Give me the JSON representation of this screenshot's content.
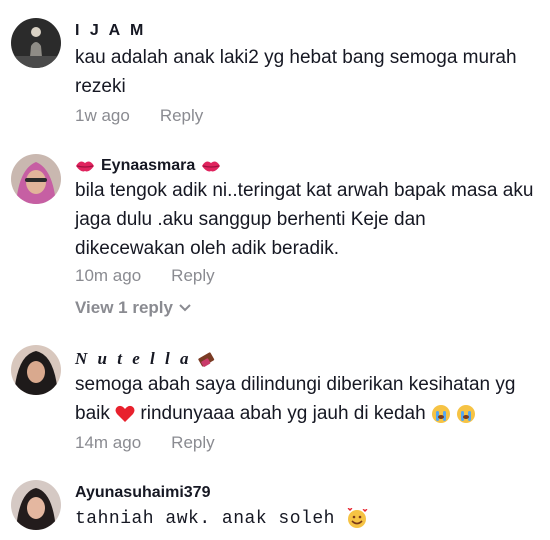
{
  "comments": [
    {
      "username": "I J A M",
      "text": "kau adalah anak laki2 yg hebat bang semoga murah rezeki",
      "time": "1w ago",
      "reply_label": "Reply"
    },
    {
      "username": "Eynaasmara",
      "username_emoji": "kiss-lips",
      "text_part1": "bila tengok adik ni..teringat kat arwah bapak masa aku jaga dulu .aku sanggup berhenti Keje dan dikecewakan oleh adik beradik.",
      "time": "10m ago",
      "reply_label": "Reply",
      "view_replies": "View 1 reply"
    },
    {
      "username": "N u t e l l a",
      "username_emoji": "chocolate-bar",
      "text_part1": "semoga abah saya dilindungi diberikan kesihatan yg baik ",
      "text_part2": " rindunyaaa abah yg jauh di kedah ",
      "time": "14m ago",
      "reply_label": "Reply"
    },
    {
      "username": "Ayunasuhaimi379",
      "text": "tahniah awk. anak soleh ",
      "text_emoji": "smiling-face-with-hearts"
    }
  ],
  "colors": {
    "text": "#161823",
    "muted": "#8a8b91",
    "heart": "#e8212d"
  }
}
